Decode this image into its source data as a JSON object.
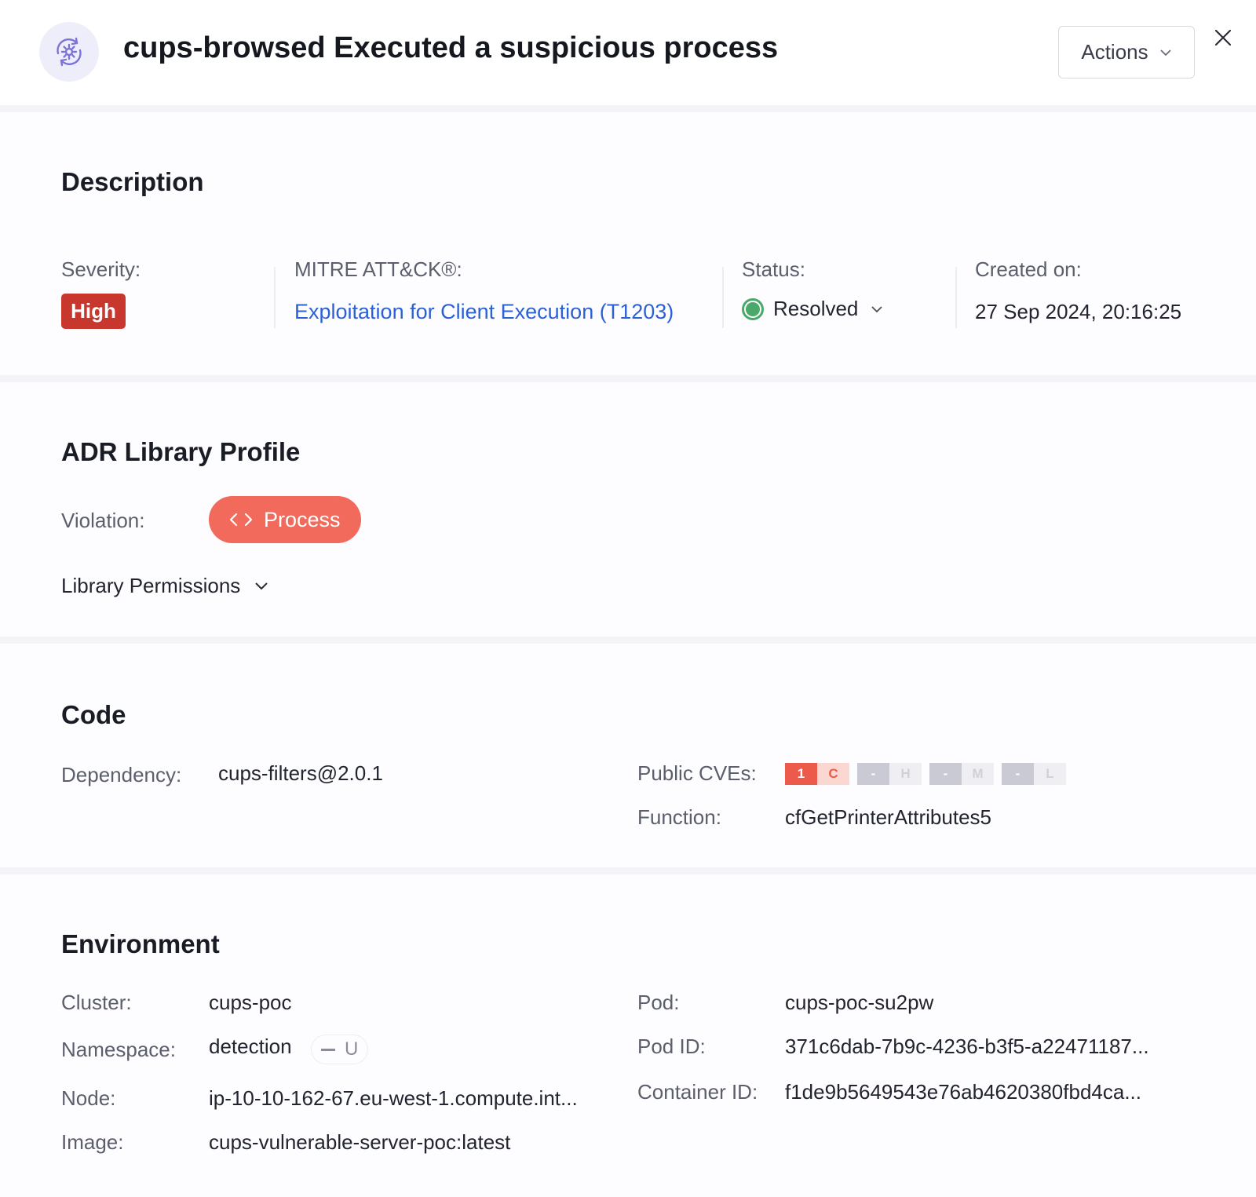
{
  "header": {
    "title": "cups-browsed Executed a suspicious process",
    "actions_label": "Actions"
  },
  "description": {
    "title": "Description",
    "severity_label": "Severity:",
    "severity_value": "High",
    "mitre_label": "MITRE ATT&CK®:",
    "mitre_value": "Exploitation for Client Execution (T1203)",
    "status_label": "Status:",
    "status_value": "Resolved",
    "created_label": "Created on:",
    "created_value": "27 Sep 2024, 20:16:25"
  },
  "adr": {
    "title": "ADR Library Profile",
    "violation_label": "Violation:",
    "violation_value": "Process",
    "library_permissions_label": "Library Permissions"
  },
  "code": {
    "title": "Code",
    "dependency_label": "Dependency:",
    "dependency_value": "cups-filters@2.0.1",
    "public_cves_label": "Public CVEs:",
    "cves": [
      {
        "count": "1",
        "level": "C"
      },
      {
        "count": "-",
        "level": "H"
      },
      {
        "count": "-",
        "level": "M"
      },
      {
        "count": "-",
        "level": "L"
      }
    ],
    "function_label": "Function:",
    "function_value": "cfGetPrinterAttributes5"
  },
  "environment": {
    "title": "Environment",
    "cluster_label": "Cluster:",
    "cluster_value": "cups-poc",
    "namespace_label": "Namespace:",
    "namespace_value": "detection",
    "namespace_tag": "U",
    "node_label": "Node:",
    "node_value": "ip-10-10-162-67.eu-west-1.compute.int...",
    "image_label": "Image:",
    "image_value": "cups-vulnerable-server-poc:latest",
    "pod_label": "Pod:",
    "pod_value": "cups-poc-su2pw",
    "pod_id_label": "Pod ID:",
    "pod_id_value": "371c6dab-7b9c-4236-b3f5-a22471187...",
    "container_id_label": "Container ID:",
    "container_id_value": "f1de9b5649543e76ab4620380fbd4ca..."
  },
  "colors": {
    "severity_high": "#c7372d",
    "link": "#2c61d6",
    "resolved": "#4aa86b",
    "process_pill": "#f26a5b"
  },
  "icons": {
    "header": "gear-sync-icon",
    "actions_chevron": "chevron-down-icon",
    "close": "close-icon",
    "status_chevron": "chevron-down-icon",
    "process": "code-icon",
    "library_chevron": "chevron-down-icon"
  }
}
